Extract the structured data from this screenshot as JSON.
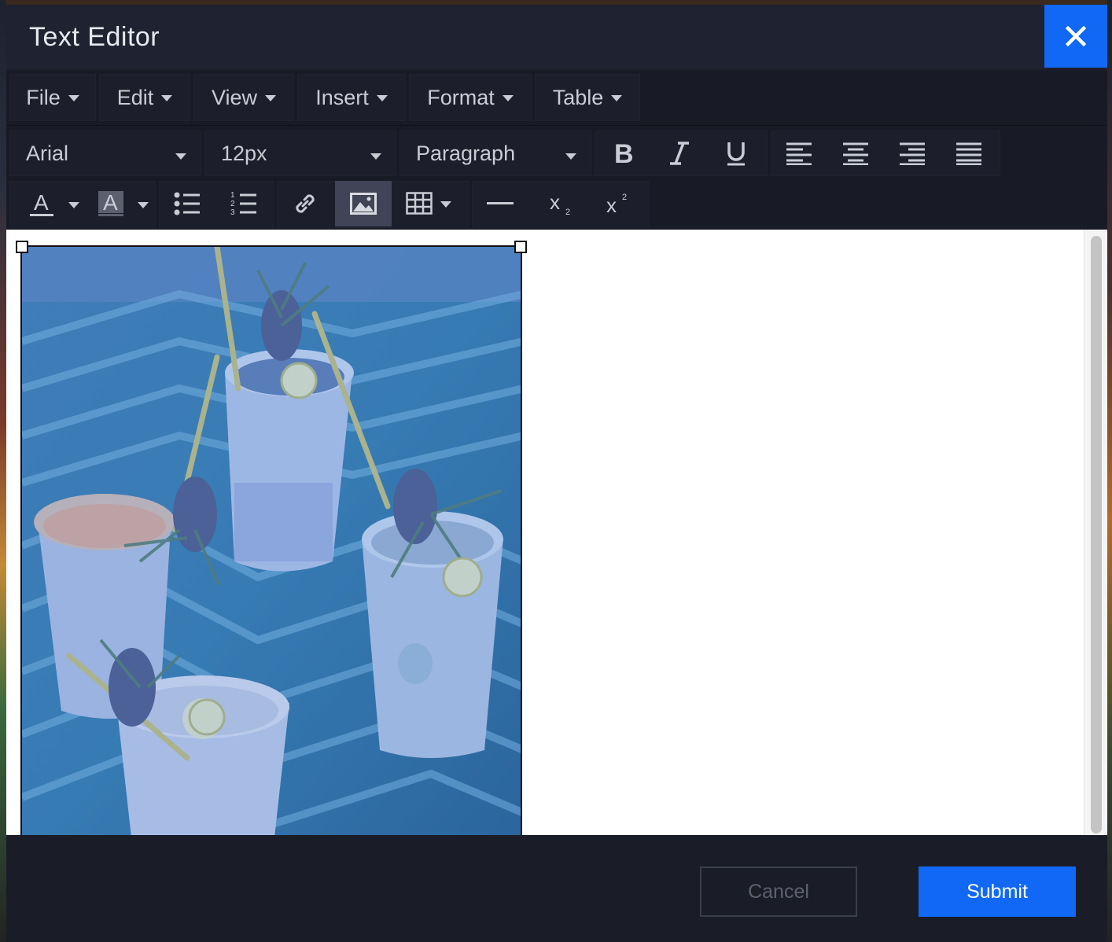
{
  "dialog": {
    "title": "Text Editor",
    "close_icon": "close-icon"
  },
  "menubar": {
    "items": [
      {
        "label": "File"
      },
      {
        "label": "Edit"
      },
      {
        "label": "View"
      },
      {
        "label": "Insert"
      },
      {
        "label": "Format"
      },
      {
        "label": "Table"
      }
    ]
  },
  "toolbar": {
    "font_family": "Arial",
    "font_size": "12px",
    "block_format": "Paragraph",
    "buttons": {
      "bold": "bold-icon",
      "italic": "italic-icon",
      "underline": "underline-icon",
      "align_left": "align-left-icon",
      "align_center": "align-center-icon",
      "align_right": "align-right-icon",
      "align_justify": "align-justify-icon",
      "text_color": "text-color-icon",
      "background_color": "background-color-icon",
      "bullet_list": "bullet-list-icon",
      "numbered_list": "numbered-list-icon",
      "link": "link-icon",
      "image": "image-icon",
      "table": "table-icon",
      "horizontal_rule": "horizontal-rule-icon",
      "subscript": "subscript-icon",
      "superscript": "superscript-icon"
    },
    "active_button": "image",
    "text_color_glyph": "A",
    "bg_color_glyph": "A",
    "subscript_glyph": "x",
    "superscript_glyph": "x"
  },
  "content": {
    "image_subject": "four cocktails in ceramic cups with pineapple and rosemary garnish on blue tile table"
  },
  "footer": {
    "cancel_label": "Cancel",
    "submit_label": "Submit"
  },
  "colors": {
    "accent": "#1068f5",
    "panel": "#1a1d28",
    "toolbar": "#181b26"
  }
}
